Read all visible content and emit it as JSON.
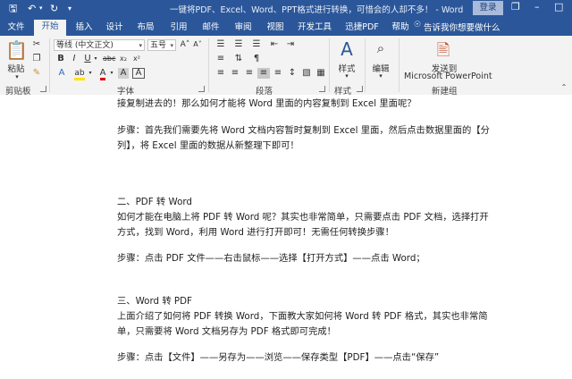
{
  "titlebar": {
    "title": "一键将PDF、Excel、Word、PPT格式进行转换，可惜会的人却不多！ - Word",
    "login_label": "登录"
  },
  "tabs": [
    {
      "label": "文件"
    },
    {
      "label": "开始"
    },
    {
      "label": "插入"
    },
    {
      "label": "设计"
    },
    {
      "label": "布局"
    },
    {
      "label": "引用"
    },
    {
      "label": "邮件"
    },
    {
      "label": "审阅"
    },
    {
      "label": "视图"
    },
    {
      "label": "开发工具"
    },
    {
      "label": "迅捷PDF"
    },
    {
      "label": "帮助"
    }
  ],
  "tell_me": "告诉我你想要做什么",
  "ribbon": {
    "clipboard": {
      "paste_label": "粘贴",
      "group_label": "剪贴板"
    },
    "font": {
      "font_name": "等线 (中文正文)",
      "font_size": "五号",
      "group_label": "字体"
    },
    "paragraph": {
      "group_label": "段落"
    },
    "styles": {
      "styles_label": "样式",
      "group_label": "样式"
    },
    "editing": {
      "edit_label": "编辑"
    },
    "new_group": {
      "send_label_1": "发送到",
      "send_label_2": "Microsoft PowerPoint",
      "group_label": "新建组"
    }
  },
  "document": {
    "lines": [
      "接复制进去的！那么如何才能将 Word 里面的内容复制到 Excel 里面呢？",
      "",
      "步骤：首先我们需要先将 Word 文档内容暂时复制到 Excel 里面，然后点击数据里面的【分",
      "列】，将 Excel 里面的数据从新整理下即可！",
      "",
      "",
      "",
      "二、PDF 转 Word",
      "如何才能在电脑上将 PDF 转 Word 呢？其实也非常简单，只需要点击 PDF 文档，选择打开",
      "方式，找到 Word，利用 Word 进行打开即可！无需任何转换步骤！",
      "",
      "步骤：点击 PDF 文件——右击鼠标——选择【打开方式】——点击 Word；",
      "",
      "",
      "三、Word 转 PDF",
      "上面介绍了如何将 PDF 转换 Word，下面教大家如何将 Word 转 PDF 格式，其实也非常简",
      "单，只需要将 Word 文档另存为 PDF 格式即可完成！",
      "",
      "步骤：点击【文件】——另存为——浏览——保存类型【PDF】——点击“保存”"
    ]
  }
}
